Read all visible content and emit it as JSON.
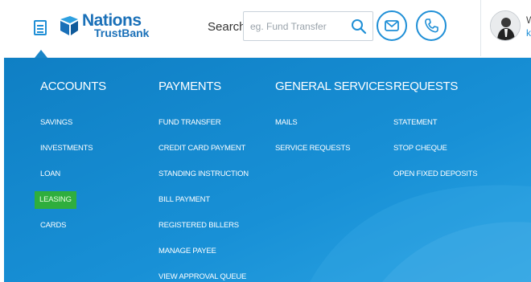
{
  "header": {
    "logo": {
      "line1": "Nations",
      "line2": "TrustBank"
    },
    "search": {
      "label": "Search",
      "placeholder": "eg. Fund Transfer"
    },
    "user": {
      "greeting": "W",
      "link": "k"
    },
    "icons": [
      "menu-icon",
      "search-icon",
      "mail-icon",
      "phone-icon",
      "avatar"
    ]
  },
  "colors": {
    "brand_blue": "#1a70b8",
    "accent_blue": "#1f8fd6",
    "menu_bg": "#158ad0",
    "highlight": "#2fae3d"
  },
  "menu": {
    "columns": [
      {
        "heading": "ACCOUNTS",
        "items": [
          "SAVINGS",
          "INVESTMENTS",
          "LOAN",
          "LEASING",
          "CARDS"
        ]
      },
      {
        "heading": "PAYMENTS",
        "items": [
          "FUND TRANSFER",
          "CREDIT CARD PAYMENT",
          "STANDING INSTRUCTION",
          "BILL PAYMENT",
          "REGISTERED BILLERS",
          "MANAGE PAYEE",
          "VIEW APPROVAL QUEUE"
        ]
      },
      {
        "heading": "GENERAL SERVICES",
        "items": [
          "MAILS",
          "SERVICE REQUESTS"
        ]
      },
      {
        "heading": "REQUESTS",
        "items": [
          "STATEMENT",
          "STOP CHEQUE",
          "OPEN FIXED DEPOSITS"
        ]
      }
    ],
    "highlighted_item": "LEASING"
  }
}
